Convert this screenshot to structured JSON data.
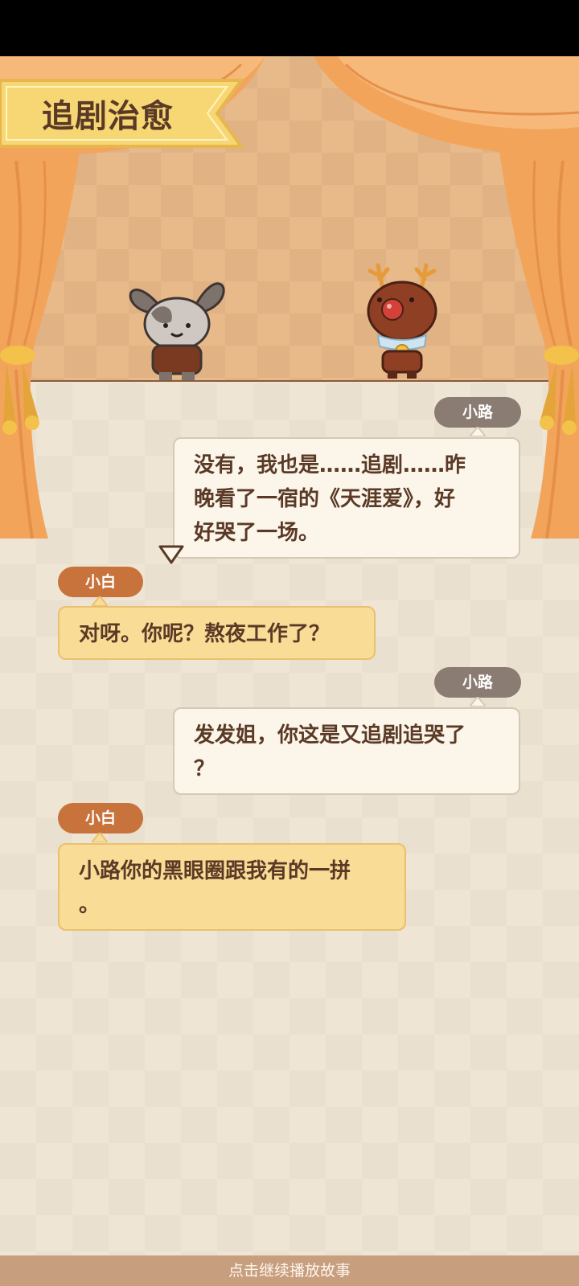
{
  "title": "追剧治愈",
  "characters": {
    "left": {
      "name": "小白",
      "icon": "bunny-character"
    },
    "right": {
      "name": "小路",
      "icon": "reindeer-character"
    }
  },
  "messages": [
    {
      "speaker": "小路",
      "text": "没有，我也是……追剧……昨\n晚看了一宿的《天涯爱》，好\n好哭了一场。"
    },
    {
      "speaker": "小白",
      "text": "对呀。你呢？熬夜工作了？"
    },
    {
      "speaker": "小路",
      "text": "发发姐，你这是又追剧追哭了\n？"
    },
    {
      "speaker": "小白",
      "text": "小路你的黑眼圈跟我有的一拼\n。"
    }
  ],
  "footer": {
    "hint": "点击继续播放故事"
  },
  "colors": {
    "stage": "#e8b989",
    "curtain": "#f3a45b",
    "banner": "#f7d774",
    "tag_gray": "#8a7c72",
    "tag_orange": "#c8733b",
    "bubble_yellow": "#f9dc96",
    "bubble_white": "#fcf6ea"
  }
}
